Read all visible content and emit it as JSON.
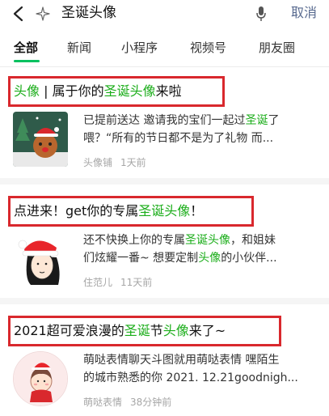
{
  "search": {
    "query": "圣诞头像",
    "cancel_label": "取消"
  },
  "tabs": [
    {
      "label": "全部",
      "active": true
    },
    {
      "label": "新闻",
      "active": false
    },
    {
      "label": "小程序",
      "active": false
    },
    {
      "label": "视频号",
      "active": false
    },
    {
      "label": "朋友圈",
      "active": false
    }
  ],
  "results": [
    {
      "title_parts": [
        {
          "text": "头像",
          "hl": true
        },
        {
          "text": " | 属于你的",
          "hl": false
        },
        {
          "text": "圣诞头像",
          "hl": true
        },
        {
          "text": "来啦",
          "hl": false
        }
      ],
      "snippet_lines": [
        [
          {
            "text": "已提前送达 邀请我的宝们一起过",
            "hl": false
          },
          {
            "text": "圣诞",
            "hl": true
          },
          {
            "text": "了",
            "hl": false
          }
        ],
        [
          {
            "text": "喂？“所有的节日都不是为了礼物 而...",
            "hl": false
          }
        ]
      ],
      "source": "头像铺",
      "time": "1天前"
    },
    {
      "title_parts": [
        {
          "text": "点进来！get你的专属",
          "hl": false
        },
        {
          "text": "圣诞头像",
          "hl": true
        },
        {
          "text": "！",
          "hl": false
        }
      ],
      "snippet_lines": [
        [
          {
            "text": "还不快换上你的专属",
            "hl": false
          },
          {
            "text": "圣诞头像",
            "hl": true
          },
          {
            "text": "，和姐妹",
            "hl": false
          }
        ],
        [
          {
            "text": "们炫耀一番~ 想要定制",
            "hl": false
          },
          {
            "text": "头像",
            "hl": true
          },
          {
            "text": "的小伙伴...",
            "hl": false
          }
        ]
      ],
      "source": "住范儿",
      "time": "11天前"
    },
    {
      "title_parts": [
        {
          "text": "2021超可爱浪漫的",
          "hl": false
        },
        {
          "text": "圣诞",
          "hl": true
        },
        {
          "text": "节",
          "hl": false
        },
        {
          "text": "头像",
          "hl": true
        },
        {
          "text": "来了~",
          "hl": false
        }
      ],
      "snippet_lines": [
        [
          {
            "text": "萌哒表情聊天斗图就用萌哒表情 嘿陌生",
            "hl": false
          }
        ],
        [
          {
            "text": "的城市熟悉的你 2021. 12.21goodnigh...",
            "hl": false
          }
        ]
      ],
      "source": "萌哒表情",
      "time": "38分钟前"
    }
  ],
  "colors": {
    "highlight": "#1aad19",
    "annotation_box": "#d9282d",
    "cancel": "#586a8f",
    "tab_underline": "#07c160"
  }
}
